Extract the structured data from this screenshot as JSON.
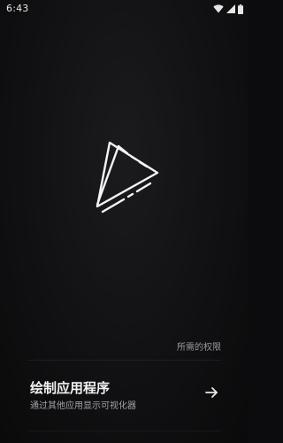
{
  "status_bar": {
    "time": "6:43",
    "icons": [
      "wifi-icon",
      "cellular-signal-icon",
      "battery-icon"
    ]
  },
  "app": {
    "logo": "play-triangle-logo"
  },
  "permissions": {
    "section_label": "所需的权限",
    "items": [
      {
        "title": "绘制应用程序",
        "description": "通过其他应用显示可视化器",
        "action_icon": "arrow-right-icon"
      }
    ]
  },
  "colors": {
    "background": "#0c0c0e",
    "text_primary": "#f2f2f2",
    "text_secondary": "#a3a3a6"
  }
}
